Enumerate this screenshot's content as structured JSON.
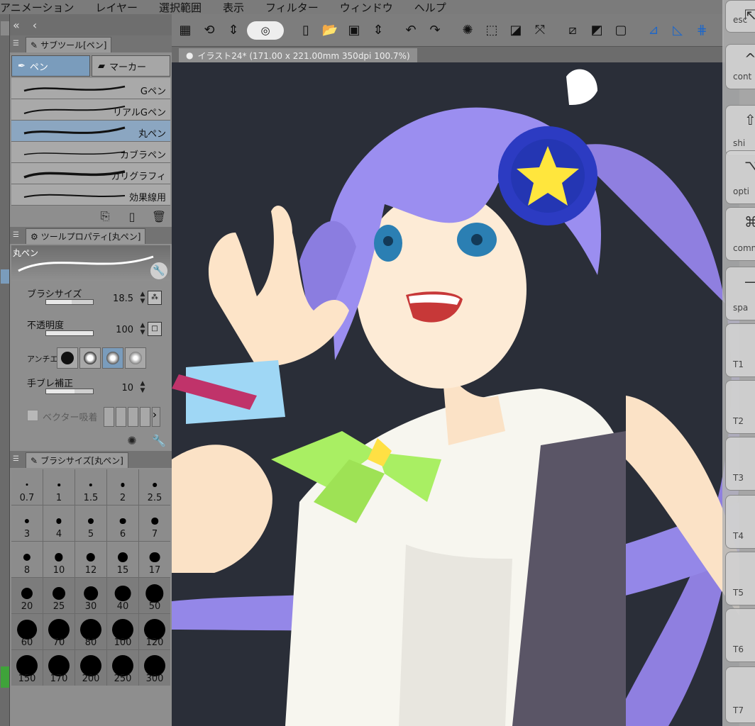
{
  "menu": [
    "アニメーション",
    "レイヤー",
    "選択範囲",
    "表示",
    "フィルター",
    "ウィンドウ",
    "ヘルプ"
  ],
  "subtool_panel": {
    "title": "サブツール[ペン]",
    "tabs": [
      {
        "label": "ペン",
        "icon": "pen-nib-icon",
        "active": true
      },
      {
        "label": "マーカー",
        "icon": "marker-icon",
        "active": false
      }
    ],
    "brushes": [
      {
        "name": "Gペン",
        "selected": false
      },
      {
        "name": "リアルGペン",
        "selected": false
      },
      {
        "name": "丸ペン",
        "selected": true
      },
      {
        "name": "カブラペン",
        "selected": false
      },
      {
        "name": "カリグラフィ",
        "selected": false
      },
      {
        "name": "効果線用",
        "selected": false
      }
    ]
  },
  "tool_property": {
    "title": "ツールプロパティ[丸ペン]",
    "preview_label": "丸ペン",
    "brush_size": {
      "label": "ブラシサイズ",
      "value": "18.5",
      "fill": 0.55
    },
    "opacity": {
      "label": "不透明度",
      "value": "100",
      "fill": 1.0
    },
    "antialias": {
      "label": "アンチエ",
      "selected_index": 2
    },
    "stabilization": {
      "label": "手ブレ補正",
      "value": "10",
      "fill": 0.6
    },
    "vector_snap": {
      "label": "ベクター吸着"
    }
  },
  "brush_size_panel": {
    "title": "ブラシサイズ[丸ペン]",
    "sizes": [
      "0.7",
      "1",
      "1.5",
      "2",
      "2.5",
      "3",
      "4",
      "5",
      "6",
      "7",
      "8",
      "10",
      "12",
      "15",
      "17",
      "20",
      "25",
      "30",
      "40",
      "50",
      "60",
      "70",
      "80",
      "100",
      "120",
      "150",
      "170",
      "200",
      "250",
      "300"
    ]
  },
  "canvas_tab": {
    "title": "イラスト24* (171.00 x 221.00mm 350dpi 100.7%)"
  },
  "right_keys": [
    {
      "sym": "⇱",
      "label": "esc"
    },
    {
      "sym": "^",
      "label": "cont"
    },
    {
      "sym": "⇧",
      "label": "shi"
    },
    {
      "sym": "⌥",
      "label": "opti"
    },
    {
      "sym": "⌘",
      "label": "comm"
    },
    {
      "sym": "—",
      "label": "spa"
    },
    {
      "sym": "",
      "label": "T1"
    },
    {
      "sym": "",
      "label": "T2"
    },
    {
      "sym": "",
      "label": "T3"
    },
    {
      "sym": "",
      "label": "T4"
    },
    {
      "sym": "",
      "label": "T5"
    },
    {
      "sym": "",
      "label": "T6"
    },
    {
      "sym": "",
      "label": "T7"
    }
  ],
  "colors": {
    "canvas_bg": "#2a2e38",
    "hair": "#8f7fe0",
    "accent_blue": "#1e67c8"
  }
}
